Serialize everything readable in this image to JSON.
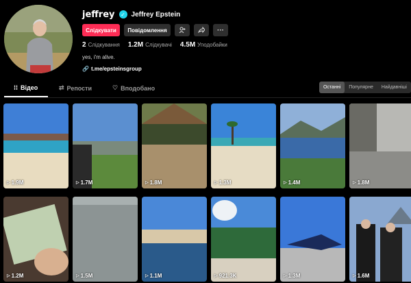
{
  "profile": {
    "username": "jeffrey",
    "display_name": "Jeffrey Epstein",
    "verified_icon": "verified-badge-icon",
    "follow_label": "Слідкувати",
    "message_label": "Повідомлення",
    "following_count": "2",
    "following_label": "Слідкування",
    "followers_count": "1.2M",
    "followers_label": "Слідкувачі",
    "likes_count": "4.5M",
    "likes_label": "Уподобайки",
    "bio": "yes, i'm alive.",
    "link": "t.me/epsteinsgroup"
  },
  "tabs": [
    {
      "label": "Відео",
      "icon": "grid-icon"
    },
    {
      "label": "Репости",
      "icon": "repost-icon"
    },
    {
      "label": "Вподобано",
      "icon": "heart-icon"
    }
  ],
  "sort": [
    "Останні",
    "Популярне",
    "Найдавніші"
  ],
  "videos": [
    {
      "views": "1.9M"
    },
    {
      "views": "1.7M"
    },
    {
      "views": "1.8M"
    },
    {
      "views": "1.3M"
    },
    {
      "views": "1.4M"
    },
    {
      "views": "1.8M"
    },
    {
      "views": "1.2M"
    },
    {
      "views": "1.5M"
    },
    {
      "views": "1.1M"
    },
    {
      "views": "921.3K"
    },
    {
      "views": "1.3M"
    },
    {
      "views": "1.6M"
    }
  ],
  "colors": {
    "accent": "#fe2c55",
    "verified": "#20d5ec"
  }
}
